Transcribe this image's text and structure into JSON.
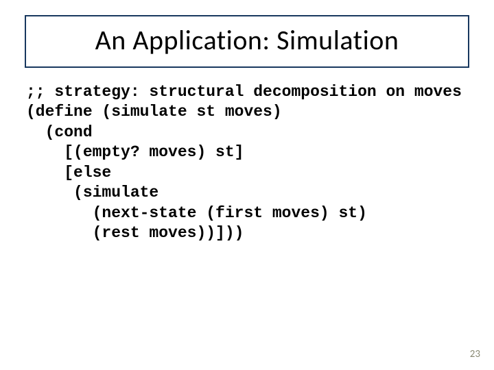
{
  "title": "An Application: Simulation",
  "code": {
    "l1": ";; strategy: structural decomposition on moves",
    "l2": "(define (simulate st moves)",
    "l3": "  (cond",
    "l4": "    [(empty? moves) st]",
    "l5": "    [else",
    "l6": "     (simulate",
    "l7": "       (next-state (first moves) st)",
    "l8": "       (rest moves))]))"
  },
  "page_number": "23"
}
